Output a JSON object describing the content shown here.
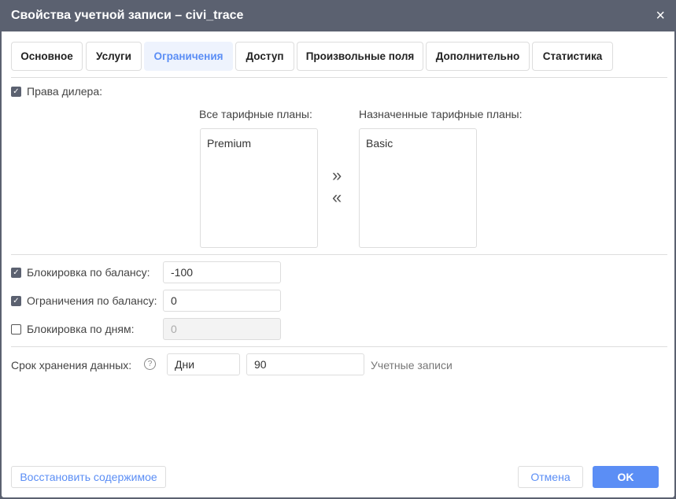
{
  "dialog": {
    "title": "Свойства учетной записи – civi_trace",
    "close_icon": "×"
  },
  "tabs": [
    {
      "label": "Основное"
    },
    {
      "label": "Услуги"
    },
    {
      "label": "Ограничения",
      "active": true
    },
    {
      "label": "Доступ"
    },
    {
      "label": "Произвольные поля"
    },
    {
      "label": "Дополнительно"
    },
    {
      "label": "Статистика"
    }
  ],
  "dealer": {
    "label": "Права дилера:",
    "checked": true,
    "all_plans_label": "Все тарифные планы:",
    "assigned_plans_label": "Назначенные тарифные планы:",
    "all_plans": [
      "Premium"
    ],
    "assigned_plans": [
      "Basic"
    ],
    "add_icon": "»",
    "remove_icon": "«"
  },
  "limits": [
    {
      "label": "Блокировка по балансу:",
      "checked": true,
      "value": "-100"
    },
    {
      "label": "Ограничения по балансу:",
      "checked": true,
      "value": "0"
    },
    {
      "label": "Блокировка по дням:",
      "checked": false,
      "value": "0"
    }
  ],
  "retention": {
    "label": "Срок хранения данных:",
    "help_icon": "?",
    "unit": "Дни",
    "value": "90",
    "suffix": "Учетные записи"
  },
  "footer": {
    "restore": "Восстановить содержимое",
    "cancel": "Отмена",
    "ok": "OK"
  },
  "colors": {
    "accent": "#5b8ef5",
    "titlebar": "#5b6170"
  }
}
